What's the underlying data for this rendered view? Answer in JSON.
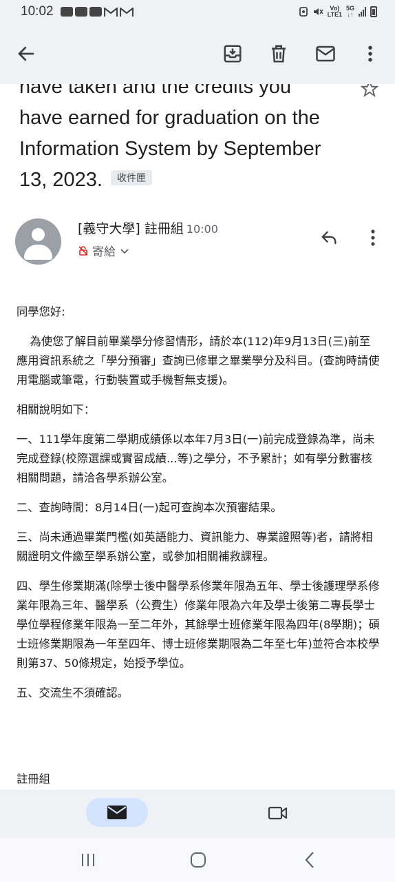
{
  "status_bar": {
    "time": "10:02",
    "network_top": "Vo)",
    "network_bottom": "LTE1",
    "net_type": "5G"
  },
  "toolbar": {
    "back_icon": "arrow-back-icon",
    "archive_icon": "archive-icon",
    "delete_icon": "trash-icon",
    "mark_unread_icon": "mail-icon",
    "more_icon": "more-vert-icon"
  },
  "email": {
    "subject_lines": [
      "have taken and the credits you",
      "have earned for graduation on the",
      "Information System by September",
      "13, 2023."
    ],
    "label_chip": "收件匣",
    "sender": "[義守大學] 註冊組",
    "time": "10:00",
    "recipient": "寄給",
    "greeting": "同學您好:",
    "paragraph_intro": "為使您了解目前畢業學分修習情形，請於本(112)年9月13日(三)前至應用資訊系統之「學分預審」查詢已修畢之畢業學分及科目。(查詢時請使用電腦或筆電，行動裝置或手機暫無支援)。",
    "related_heading": "相關說明如下：",
    "items": [
      "一、111學年度第二學期成績係以本年7月3日(一)前完成登錄為準，尚未完成登錄(校際選課或實習成績...等)之學分，不予累計；如有學分數審核相關問題，請洽各學系辦公室。",
      "二、查詢時間：8月14日(一)起可查詢本次預審結果。",
      "三、尚未通過畢業門檻(如英語能力、資訊能力、專業證照等)者，請將相關證明文件繳至學系辦公室，或參加相關補救課程。",
      "四、學生修業期滿(除學士後中醫學系修業年限為五年、學士後護理學系修業年限為三年、醫學系（公費生）修業年限為六年及學士後第二專長學士學位學程修業年限為一至二年外，其餘學士班修業年限為四年(8學期)；碩士班修業期限為一年至四年、博士班修業期限為二年至七年)並符合本校學則第37、50條規定，始授予學位。",
      "五、交流生不須確認。"
    ],
    "signature": "註冊組"
  },
  "colors": {
    "chrome": "#eef1f6",
    "active_pill": "#d3e3fd",
    "text": "#1f1f1f",
    "secondary": "#5f6368"
  }
}
